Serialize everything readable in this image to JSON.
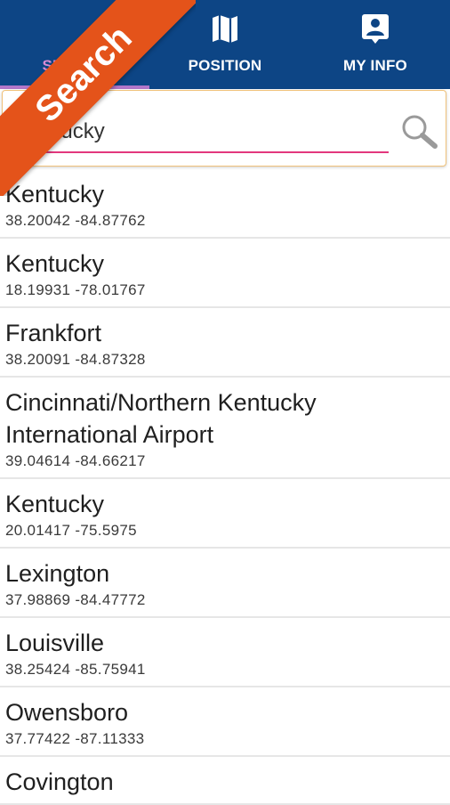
{
  "tabs": [
    {
      "label": "SEARCH",
      "icon": "magnifier-icon"
    },
    {
      "label": "POSITION",
      "icon": "map-icon"
    },
    {
      "label": "MY INFO",
      "icon": "contact-card-icon"
    }
  ],
  "banner": {
    "text": "Search"
  },
  "search": {
    "value": "Kentucky"
  },
  "results": [
    {
      "name": "Kentucky",
      "coords": "38.20042 -84.87762"
    },
    {
      "name": "Kentucky",
      "coords": "18.19931 -78.01767"
    },
    {
      "name": "Frankfort",
      "coords": "38.20091 -84.87328"
    },
    {
      "name": "Cincinnati/Northern Kentucky International Airport",
      "coords": "39.04614 -84.66217"
    },
    {
      "name": "Kentucky",
      "coords": "20.01417 -75.5975"
    },
    {
      "name": "Lexington",
      "coords": "37.98869 -84.47772"
    },
    {
      "name": "Louisville",
      "coords": "38.25424 -85.75941"
    },
    {
      "name": "Owensboro",
      "coords": "37.77422 -87.11333"
    },
    {
      "name": "Covington",
      "coords": ""
    }
  ],
  "colors": {
    "tabbar": "#0d4585",
    "accent": "#e2377d",
    "banner": "#e4531a"
  }
}
